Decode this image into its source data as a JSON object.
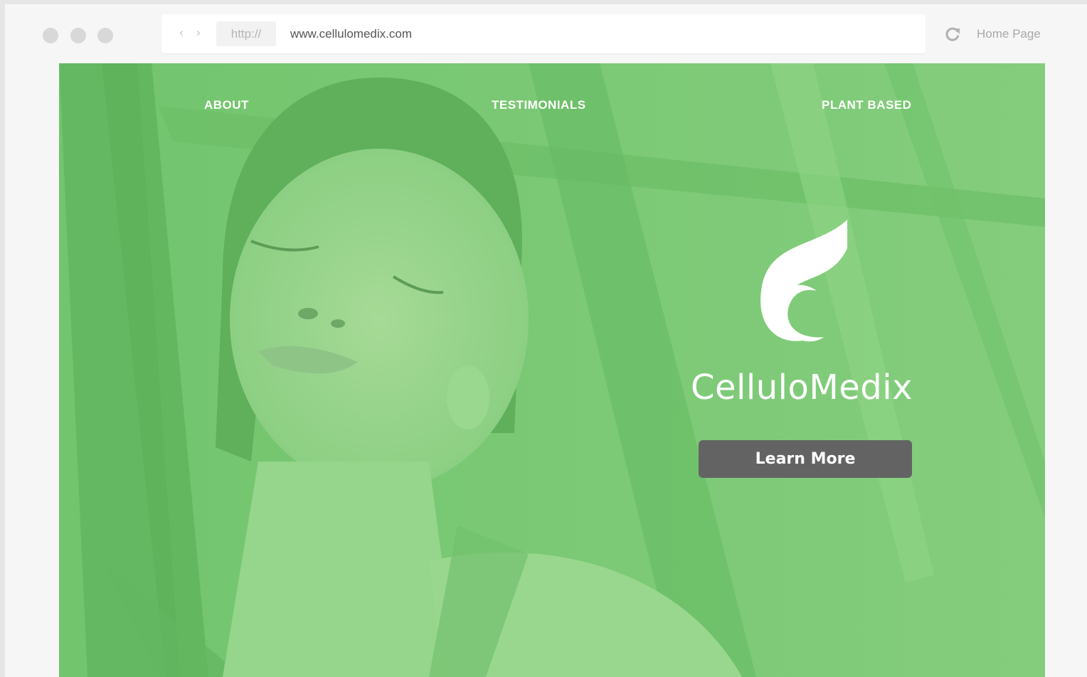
{
  "browser": {
    "scheme": "http://",
    "url": "www.cellulomedix.com",
    "home_label": "Home Page",
    "back_glyph": "‹",
    "forward_glyph": "›",
    "icons": [
      "back-arrow-icon",
      "forward-arrow-icon",
      "reload-icon"
    ]
  },
  "site": {
    "nav": {
      "about": "ABOUT",
      "testimonials": "TESTIMONIALS",
      "plant_based": "PLANT BASED"
    },
    "brand_name": "CelluloMedix",
    "cta_label": "Learn More",
    "logo_icon": "leaf-logo-icon",
    "colors": {
      "overlay_green": "#7ec879",
      "button_gray": "#636363",
      "text_white": "#ffffff"
    }
  }
}
